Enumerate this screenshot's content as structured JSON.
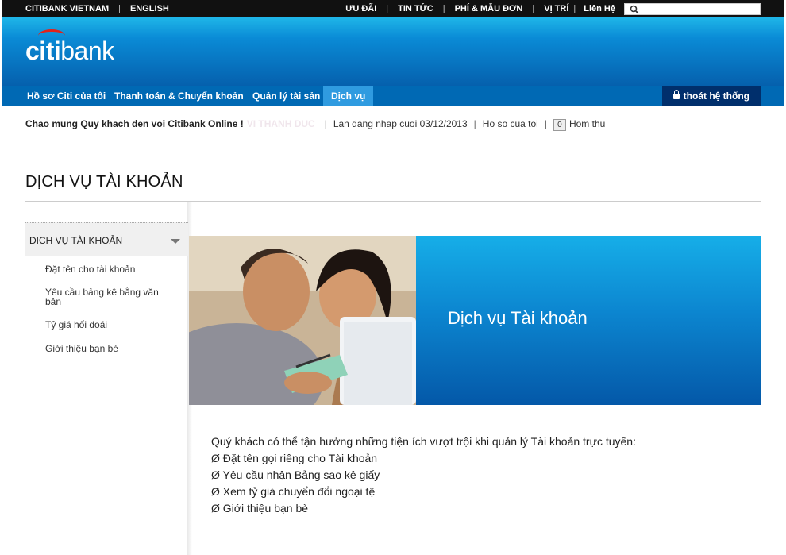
{
  "topbar": {
    "brand": "CITIBANK VIETNAM",
    "lang": "ENGLISH",
    "links": [
      "ƯU ĐÃI",
      "TIN TỨC",
      "PHÍ & MẪU ĐƠN",
      "VỊ TRÍ",
      "Liên Hệ"
    ],
    "search_value": "",
    "search_icon": "search-icon"
  },
  "header": {
    "logo_left": "citi",
    "logo_right": "bank",
    "logo_arc_color": "#e2231a"
  },
  "nav": {
    "items": [
      "Hồ sơ Citi của tôi",
      "Thanh toán & Chuyển khoản",
      "Quản lý tài sản",
      "Dịch vụ"
    ],
    "active_index": 3,
    "logout": "thoát hệ thống",
    "logout_icon": "lock-icon"
  },
  "status": {
    "welcome": "Chao mung Quy khach den voi Citibank Online !",
    "faded_name": "VI THANH DUC",
    "last_login": "Lan dang nhap cuoi 03/12/2013",
    "profile": "Ho so cua toi",
    "mail_count": "0",
    "mail_label": "Hom thu"
  },
  "page": {
    "title": "DỊCH VỤ TÀI KHOẢN"
  },
  "sidebar": {
    "heading": "DỊCH VỤ TÀI KHOẢN",
    "items": [
      "Đặt tên cho tài khoản",
      "Yêu cầu bảng kê bằng văn bản",
      "Tỷ giá hối đoái",
      "Giới thiệu bạn bè"
    ]
  },
  "hero": {
    "title": "Dịch vụ Tài khoản"
  },
  "content": {
    "intro": "Quý khách có thể tận hưởng những tiện ích vượt trội khi quản lý Tài khoản trực tuyến:",
    "bullets": [
      "Ø Đặt tên gọi riêng cho Tài khoản",
      "Ø Yêu cầu nhận Bảng sao kê giấy",
      "Ø Xem tỷ giá chuyển đổi ngoại tệ",
      "Ø Giới thiệu bạn bè"
    ]
  },
  "colors": {
    "nav": "#0069b4",
    "nav_active": "#2f9be0",
    "logout_bg": "#002f6c",
    "topbar": "#111111"
  }
}
